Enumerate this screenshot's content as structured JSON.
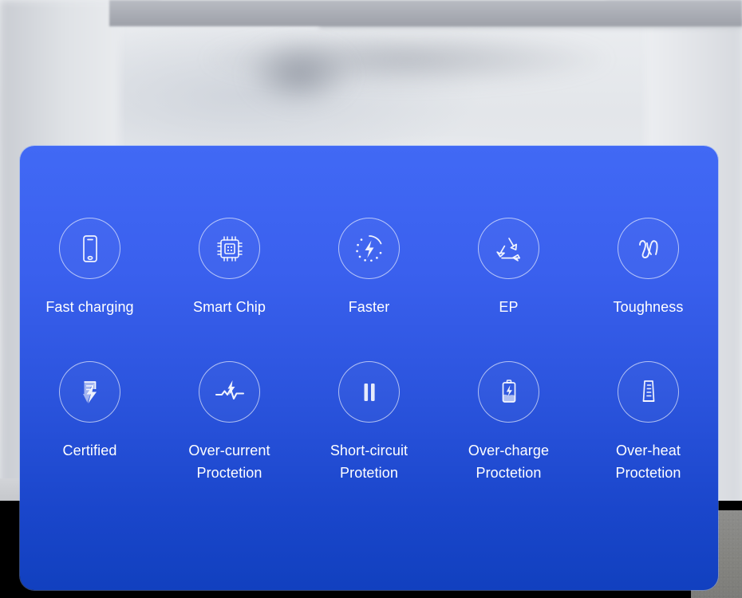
{
  "background": {
    "description": "blurred gray product photograph backdrop",
    "top_bar_color": "#a9acb4",
    "upper_color": "#e7e9ec",
    "lower_color": "#000000",
    "lower_right_color": "#83837f"
  },
  "panel": {
    "background_top_color": "#4169f5",
    "background_bottom_color": "#1140bf",
    "text_color": "#ffffff",
    "rows": [
      {
        "items": [
          {
            "icon": "smartphone-icon",
            "label": "Fast charging"
          },
          {
            "icon": "chip-icon",
            "label": "Smart Chip"
          },
          {
            "icon": "speed-gauge-bolt-icon",
            "label": "Faster"
          },
          {
            "icon": "recycle-icon",
            "label": "EP"
          },
          {
            "icon": "wavy-cable-icon",
            "label": "Toughness"
          }
        ]
      },
      {
        "items": [
          {
            "icon": "certificate-bolt-icon",
            "label": "Certified"
          },
          {
            "icon": "current-waveform-bolt-icon",
            "label": "Over-current\nProctetion"
          },
          {
            "icon": "pause-icon",
            "label": "Short-circuit\nProtetion"
          },
          {
            "icon": "battery-bolt-icon",
            "label": "Over-charge\nProctetion"
          },
          {
            "icon": "graduated-cylinder-icon",
            "label": "Over-heat\nProctetion"
          }
        ]
      }
    ]
  }
}
